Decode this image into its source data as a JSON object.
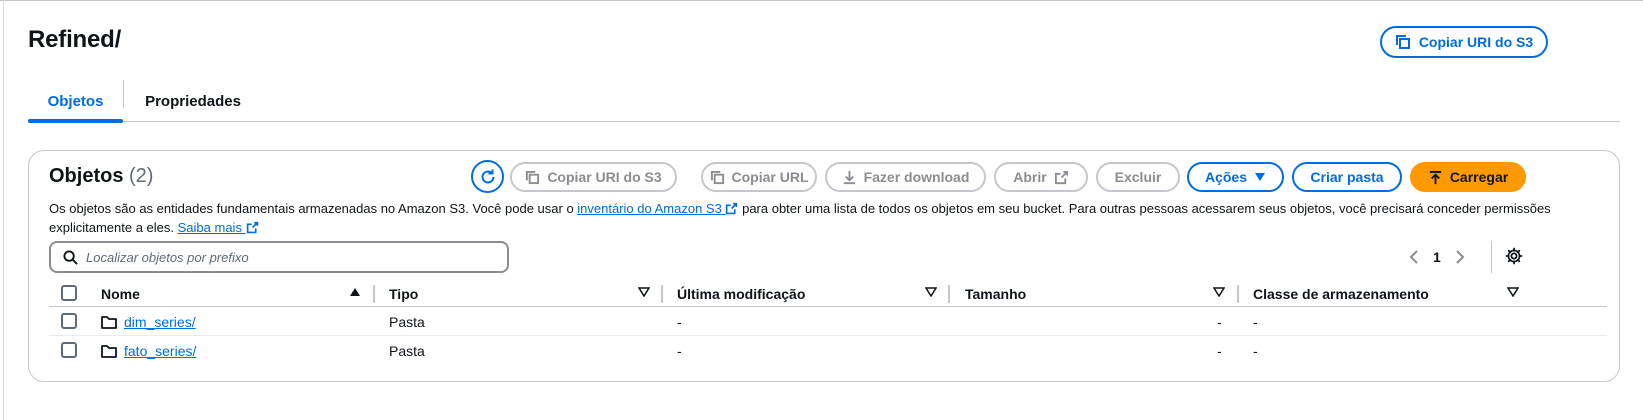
{
  "header": {
    "title": "Refined/",
    "copy_uri_label": "Copiar URI do S3"
  },
  "tabs": [
    {
      "label": "Objetos",
      "active": true
    },
    {
      "label": "Propriedades",
      "active": false
    }
  ],
  "objects_panel": {
    "title": "Objetos",
    "count": "(2)",
    "toolbar": {
      "copy_uri": "Copiar URI do S3",
      "copy_url": "Copiar URL",
      "download": "Fazer download",
      "open": "Abrir",
      "delete": "Excluir",
      "actions": "Ações",
      "create_folder": "Criar pasta",
      "upload": "Carregar"
    },
    "description": {
      "part1": "Os objetos são as entidades fundamentais armazenadas no Amazon S3. Você pode usar o",
      "inventory_link": "inventário do Amazon S3",
      "part2": "para obter uma lista de todos os objetos em seu bucket. Para outras pessoas acessarem seus objetos, você precisará conceder permissões explicitamente a eles.",
      "learn_more": "Saiba mais"
    },
    "search": {
      "placeholder": "Localizar objetos por prefixo",
      "value": ""
    },
    "pagination": {
      "current_page": "1"
    },
    "table": {
      "columns": [
        "Nome",
        "Tipo",
        "Última modificação",
        "Tamanho",
        "Classe de armazenamento"
      ],
      "rows": [
        {
          "name": "dim_series/",
          "type": "Pasta",
          "modified": "-",
          "size": "-",
          "storage_class": "-"
        },
        {
          "name": "fato_series/",
          "type": "Pasta",
          "modified": "-",
          "size": "-",
          "storage_class": "-"
        }
      ]
    }
  },
  "colors": {
    "accent": "#006ce0",
    "upload_button": "#ff9900",
    "border": "#c6c6cd",
    "text": "#0f141a",
    "muted": "#5f6b7a"
  },
  "icons": {
    "copy": "copy-icon",
    "refresh": "refresh-icon",
    "download": "download-icon",
    "external": "external-link-icon",
    "caret": "caret-down-icon",
    "upload": "upload-icon",
    "search": "search-icon",
    "folder": "folder-icon",
    "settings": "gear-icon",
    "sort_asc": "sort-ascending-icon",
    "sort": "sort-icon"
  }
}
